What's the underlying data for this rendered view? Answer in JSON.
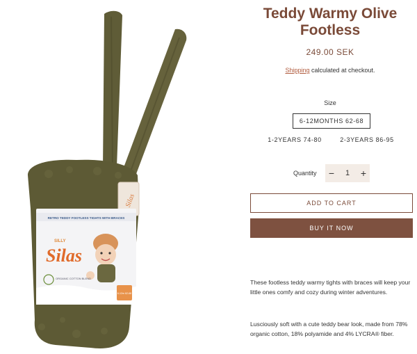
{
  "product": {
    "title": "Teddy Warmy Olive Footless",
    "price": "249.00 SEK",
    "shipping_link": "Shipping",
    "shipping_text": " calculated at checkout."
  },
  "size": {
    "label": "Size",
    "options": [
      "6-12MONTHS 62-68",
      "1-2YEARS 74-80",
      "2-3YEARS 86-95"
    ],
    "selected": "6-12MONTHS 62-68"
  },
  "quantity": {
    "label": "Quantity",
    "value": "1",
    "minus": "−",
    "plus": "+"
  },
  "buttons": {
    "add_to_cart": "ADD TO CART",
    "buy_now": "BUY IT NOW"
  },
  "description": [
    "These footless teddy warmy tights with braces will keep your little ones comfy and cozy during winter adventures.",
    "Lusciously soft with a cute teddy bear look, made from 78% organic cotton, 18% polyamide and 4% LYCRA® fiber."
  ],
  "packaging": {
    "band_text": "RETRO TEDDY FOOTLESS TIGHTS WITH BRACES",
    "brand_small": "SILLY",
    "brand_big": "Silas",
    "organic_text": "ORGANIC COTTON BLEND",
    "size_tag": "6-12m 62-68",
    "side_brand": "Silas"
  },
  "colors": {
    "accent": "#7a4a38",
    "buy_button": "#7e5140",
    "olive": "#5d5a35"
  }
}
